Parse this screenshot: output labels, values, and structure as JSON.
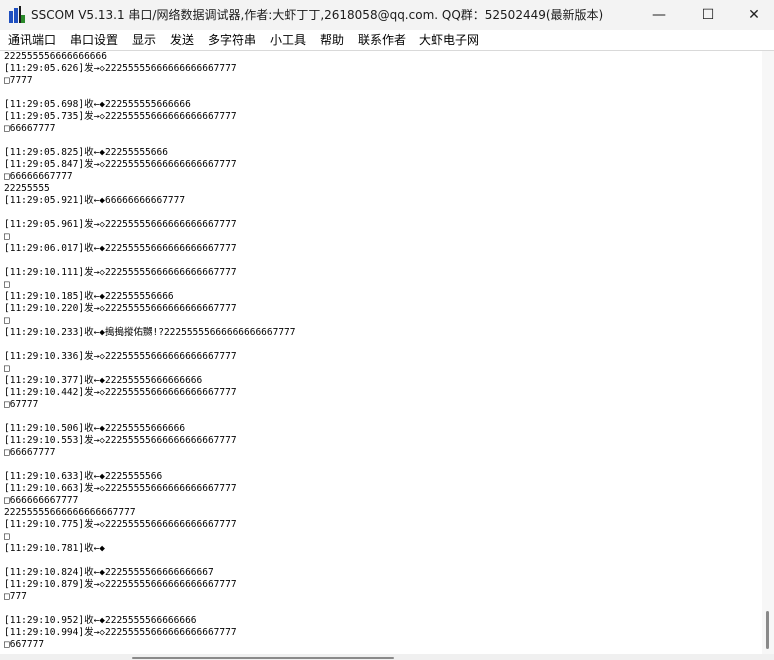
{
  "window": {
    "title": "SSCOM V5.13.1 串口/网络数据调试器,作者:大虾丁丁,2618058@qq.com. QQ群：52502449(最新版本)",
    "icon": "sscom-app-icon",
    "controls": {
      "minimize": "—",
      "maximize": "☐",
      "close": "✕"
    }
  },
  "menu": {
    "items": [
      {
        "label": "通讯端口"
      },
      {
        "label": "串口设置"
      },
      {
        "label": "显示"
      },
      {
        "label": "发送"
      },
      {
        "label": "多字符串"
      },
      {
        "label": "小工具"
      },
      {
        "label": "帮助"
      },
      {
        "label": "联系作者"
      },
      {
        "label": "大虾电子网"
      }
    ]
  },
  "log": {
    "lines": [
      "222555556666666666",
      "[11:29:05.626]发→◇22255555666666666667777",
      "□7777",
      "",
      "[11:29:05.698]收←◆222555555666666",
      "[11:29:05.735]发→◇22255555666666666667777",
      "□66667777",
      "",
      "[11:29:05.825]收←◆22255555666",
      "[11:29:05.847]发→◇22255555666666666667777",
      "□66666667777",
      "22255555",
      "[11:29:05.921]收←◆66666666667777",
      "",
      "[11:29:05.961]发→◇22255555666666666667777",
      "□",
      "[11:29:06.017]收←◆22255555666666666667777",
      "",
      "[11:29:10.111]发→◇22255555666666666667777",
      "□",
      "[11:29:10.185]收←◆222555556666",
      "[11:29:10.220]发→◇22255555666666666667777",
      "□",
      "[11:29:10.233]收←◆搗搗摐佑嬲!?22255555666666666667777",
      "",
      "[11:29:10.336]发→◇22255555666666666667777",
      "□",
      "[11:29:10.377]收←◆22255555666666666",
      "[11:29:10.442]发→◇22255555666666666667777",
      "□67777",
      "",
      "[11:29:10.506]收←◆22255555666666",
      "[11:29:10.553]发→◇22255555666666666667777",
      "□66667777",
      "",
      "[11:29:10.633]收←◆2225555566",
      "[11:29:10.663]发→◇22255555666666666667777",
      "□666666667777",
      "22255555666666666667777",
      "[11:29:10.775]发→◇22255555666666666667777",
      "□",
      "[11:29:10.781]收←◆",
      "",
      "[11:29:10.824]收←◆2225555566666666667",
      "[11:29:10.879]发→◇22255555666666666667777",
      "□777",
      "",
      "[11:29:10.952]收←◆2225555566666666",
      "[11:29:10.994]发→◇22255555666666666667777",
      "□667777"
    ]
  }
}
